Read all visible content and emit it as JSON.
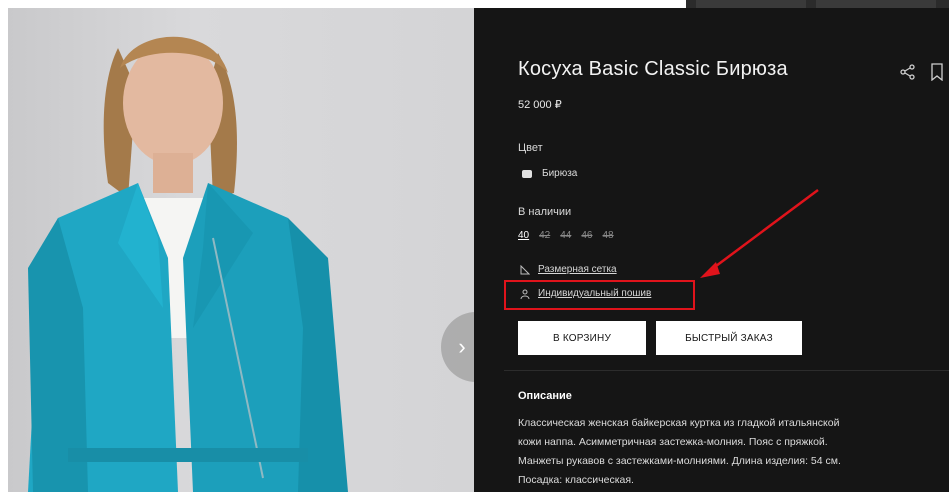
{
  "product": {
    "title": "Косуха Basic Classic Бирюза",
    "price": "52 000 ₽",
    "color_label": "Цвет",
    "color_value": "Бирюза",
    "availability_label": "В наличии",
    "sizes": [
      {
        "label": "40",
        "available": true
      },
      {
        "label": "42",
        "available": false
      },
      {
        "label": "44",
        "available": false
      },
      {
        "label": "46",
        "available": false
      },
      {
        "label": "48",
        "available": false
      }
    ],
    "size_chart_link": "Размерная сетка",
    "custom_tailoring_link": "Индивидуальный пошив",
    "add_to_cart": "В КОРЗИНУ",
    "quick_order": "БЫСТРЫЙ ЗАКАЗ",
    "description_title": "Описание",
    "description_text": "Классическая женская байкерская куртка из гладкой итальянской\nкожи наппа. Асимметричная застежка-молния. Пояс с пряжкой.\nМанжеты рукавов с застежками-молниями. Длина изделия: 54 см.\nПосадка: классическая."
  },
  "icons": {
    "share": "share-icon",
    "bookmark": "bookmark-icon",
    "next": "chevron-right-icon",
    "ruler": "ruler-icon",
    "tailor": "person-icon"
  },
  "colors": {
    "panel_bg": "#151515",
    "annotation_red": "#e0131b",
    "jacket_turquoise": "#1fa7c4"
  }
}
